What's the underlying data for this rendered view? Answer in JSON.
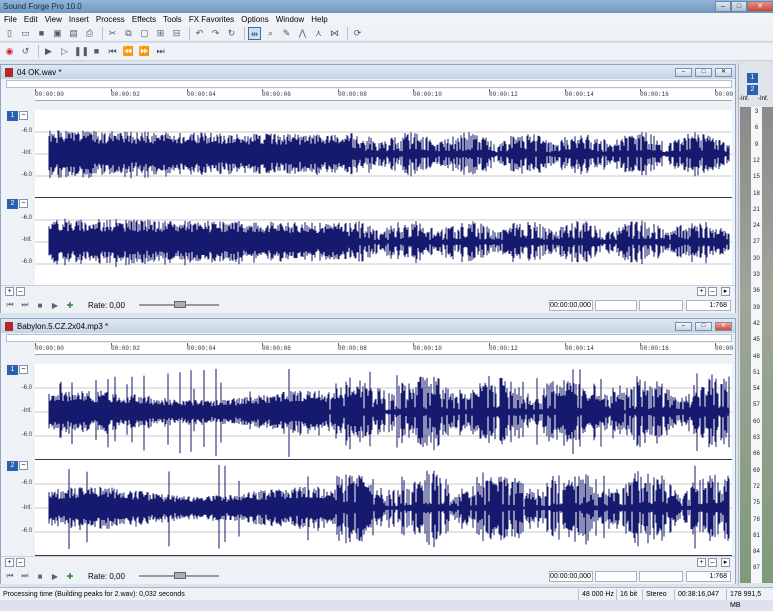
{
  "app": {
    "title": "Sound Forge Pro 10.0",
    "win_min": "–",
    "win_max": "□",
    "win_close": "✕"
  },
  "menu": [
    "File",
    "Edit",
    "View",
    "Insert",
    "Process",
    "Effects",
    "Tools",
    "FX Favorites",
    "Options",
    "Window",
    "Help"
  ],
  "docs": [
    {
      "name": "04 OK.wav *",
      "ruler": [
        "00:00:00",
        "00:00:02",
        "00:00:04",
        "00:00:06",
        "00:00:08",
        "00:00:10",
        "00:00:12",
        "00:00:14",
        "00:00:16",
        "00:00"
      ],
      "channels": [
        {
          "num": "1",
          "db": [
            "-6.0",
            "-Inf.",
            "-6.0"
          ]
        },
        {
          "num": "2",
          "db": [
            "-6.0",
            "-Inf.",
            "-6.0"
          ]
        }
      ],
      "rate_label": "Rate: 0,00",
      "position": "00:00:00,000",
      "zoom": "1:768"
    },
    {
      "name": "Babylon.5.CZ.2x04.mp3 *",
      "ruler": [
        "00:00:00",
        "00:00:02",
        "00:00:04",
        "00:00:06",
        "00:00:08",
        "00:00:10",
        "00:00:12",
        "00:00:14",
        "00:00:16",
        "00:00"
      ],
      "channels": [
        {
          "num": "1",
          "db": [
            "-6.0",
            "-Inf.",
            "-6.0"
          ]
        },
        {
          "num": "2",
          "db": [
            "-6.0",
            "-Inf.",
            "-6.0"
          ]
        }
      ],
      "rate_label": "Rate: 0,00",
      "position": "00:00:00,000",
      "zoom": "1:768"
    }
  ],
  "meter": {
    "ch1": "1",
    "ch2": "2",
    "left_top": "-Inf.",
    "right_top": "-Inf.",
    "scale": [
      "3",
      "6",
      "9",
      "12",
      "15",
      "18",
      "21",
      "24",
      "27",
      "30",
      "33",
      "36",
      "39",
      "42",
      "45",
      "48",
      "51",
      "54",
      "57",
      "60",
      "63",
      "66",
      "69",
      "72",
      "75",
      "78",
      "81",
      "84",
      "87"
    ]
  },
  "status": {
    "message": "Processing time (Building peaks for 2.wav): 0,032 seconds",
    "sample_rate": "48 000 Hz",
    "bit_depth": "16 bit",
    "channels": "Stereo",
    "length": "00:38:16,047",
    "free_space": "178 991,5 MB"
  },
  "colors": {
    "waveform": "#151a6e",
    "accent": "#2c5fb2"
  }
}
